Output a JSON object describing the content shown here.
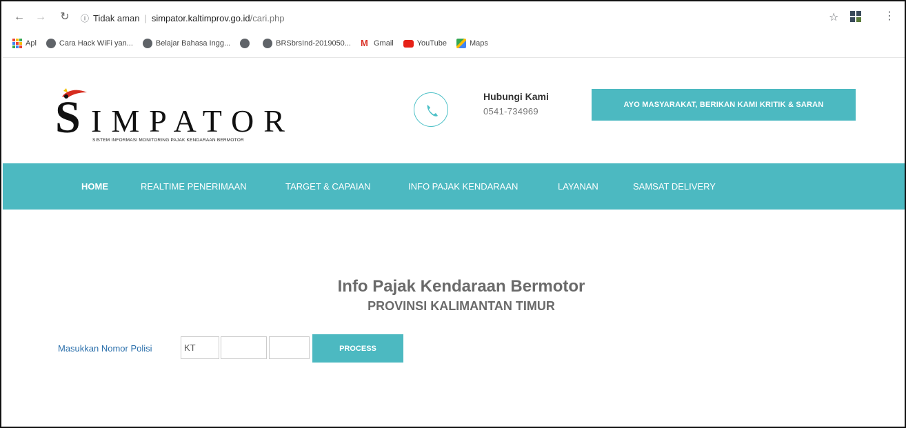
{
  "browser": {
    "security_label": "Tidak aman",
    "url_host": "simpator.kaltimprov.go.id",
    "url_path": "/cari.php",
    "bookmarks": [
      {
        "label": "Apl",
        "icon": "apps-grid-icon"
      },
      {
        "label": "Cara Hack WiFi yan...",
        "icon": "globe-icon"
      },
      {
        "label": "Belajar Bahasa Ingg...",
        "icon": "globe-icon"
      },
      {
        "label": "",
        "icon": "globe-icon"
      },
      {
        "label": "BRSbrsInd-2019050...",
        "icon": "globe-icon"
      },
      {
        "label": "Gmail",
        "icon": "gmail-icon"
      },
      {
        "label": "YouTube",
        "icon": "youtube-icon"
      },
      {
        "label": "Maps",
        "icon": "maps-icon"
      }
    ]
  },
  "header": {
    "logo": {
      "letter": "S",
      "word": "IMPATOR",
      "subtitle": "SISTEM INFORMASI MONITORING PAJAK KENDARAAN BERMOTOR"
    },
    "contact": {
      "title": "Hubungi Kami",
      "phone": "0541-734969"
    },
    "cta_label": "AYO MASYARAKAT, BERIKAN KAMI KRITIK & SARAN"
  },
  "nav": {
    "items": [
      {
        "label": "HOME",
        "active": true
      },
      {
        "label": "REALTIME PENERIMAAN",
        "active": false
      },
      {
        "label": "TARGET & CAPAIAN",
        "active": false
      },
      {
        "label": "INFO PAJAK KENDARAAN",
        "active": false
      },
      {
        "label": "LAYANAN",
        "active": false
      },
      {
        "label": "SAMSAT DELIVERY",
        "active": false
      }
    ]
  },
  "main": {
    "title": "Info Pajak Kendaraan Bermotor",
    "subtitle": "PROVINSI KALIMANTAN TIMUR",
    "form": {
      "label": "Masukkan Nomor Polisi",
      "prefix_value": "KT",
      "number_value": "",
      "suffix_value": "",
      "button_label": "PROCESS"
    }
  },
  "colors": {
    "accent": "#4cb9c1",
    "label_blue": "#2a6fab",
    "heading_gray": "#6a6a6a"
  }
}
